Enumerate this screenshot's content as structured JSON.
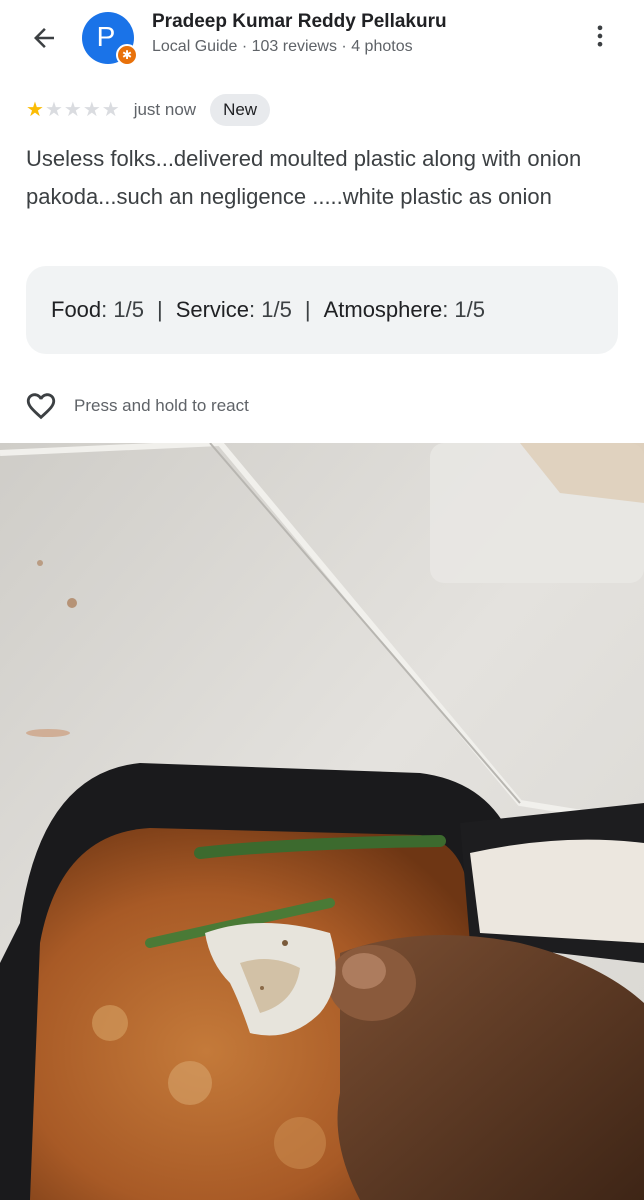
{
  "header": {
    "back_icon": "arrow-back-icon",
    "avatar_letter": "P",
    "user_name": "Pradeep Kumar Reddy Pellakuru",
    "user_meta": "Local Guide · 103 reviews · 4 photos",
    "more_icon": "more-vert-icon"
  },
  "review": {
    "rating": 1,
    "rating_max": 5,
    "time": "just now",
    "badge": "New",
    "text": "Useless folks...delivered moulted plastic along with onion pakoda...such an negligence .....white plastic as onion",
    "sub_ratings": [
      {
        "label": "Food",
        "value": ": 1/5"
      },
      {
        "label": "Service",
        "value": ": 1/5"
      },
      {
        "label": "Atmosphere",
        "value": ": 1/5"
      }
    ],
    "separator": "|",
    "react_icon": "heart-outline-icon",
    "react_text": "Press and hold to react"
  },
  "colors": {
    "star_filled": "#fbbc04",
    "star_empty": "#dadce0",
    "avatar_bg": "#1a73e8",
    "badge_bg": "#e8710a"
  }
}
